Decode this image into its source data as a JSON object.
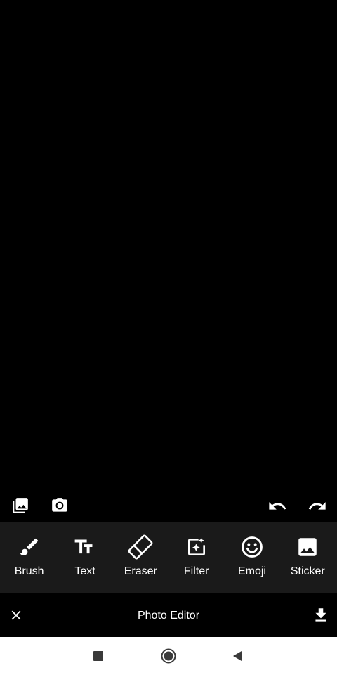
{
  "canvas": {
    "background": "#000000"
  },
  "top_actions": [
    {
      "name": "gallery-icon"
    },
    {
      "name": "camera-icon"
    },
    {
      "name": "undo-icon"
    },
    {
      "name": "redo-icon"
    }
  ],
  "tools": [
    {
      "label": "Brush",
      "icon": "brush-icon"
    },
    {
      "label": "Text",
      "icon": "text-icon"
    },
    {
      "label": "Eraser",
      "icon": "eraser-icon"
    },
    {
      "label": "Filter",
      "icon": "filter-icon"
    },
    {
      "label": "Emoji",
      "icon": "emoji-icon"
    },
    {
      "label": "Sticker",
      "icon": "sticker-icon"
    }
  ],
  "bottom_bar": {
    "title": "Photo Editor",
    "close_icon": "close-icon",
    "save_icon": "download-icon"
  },
  "nav_bar": {
    "buttons": [
      "recents-icon",
      "home-icon",
      "back-icon"
    ]
  },
  "colors": {
    "tool_panel": "#1a1a1a",
    "text": "#ffffff",
    "nav_bar": "#ffffff",
    "nav_icon": "#3a3a3a"
  }
}
